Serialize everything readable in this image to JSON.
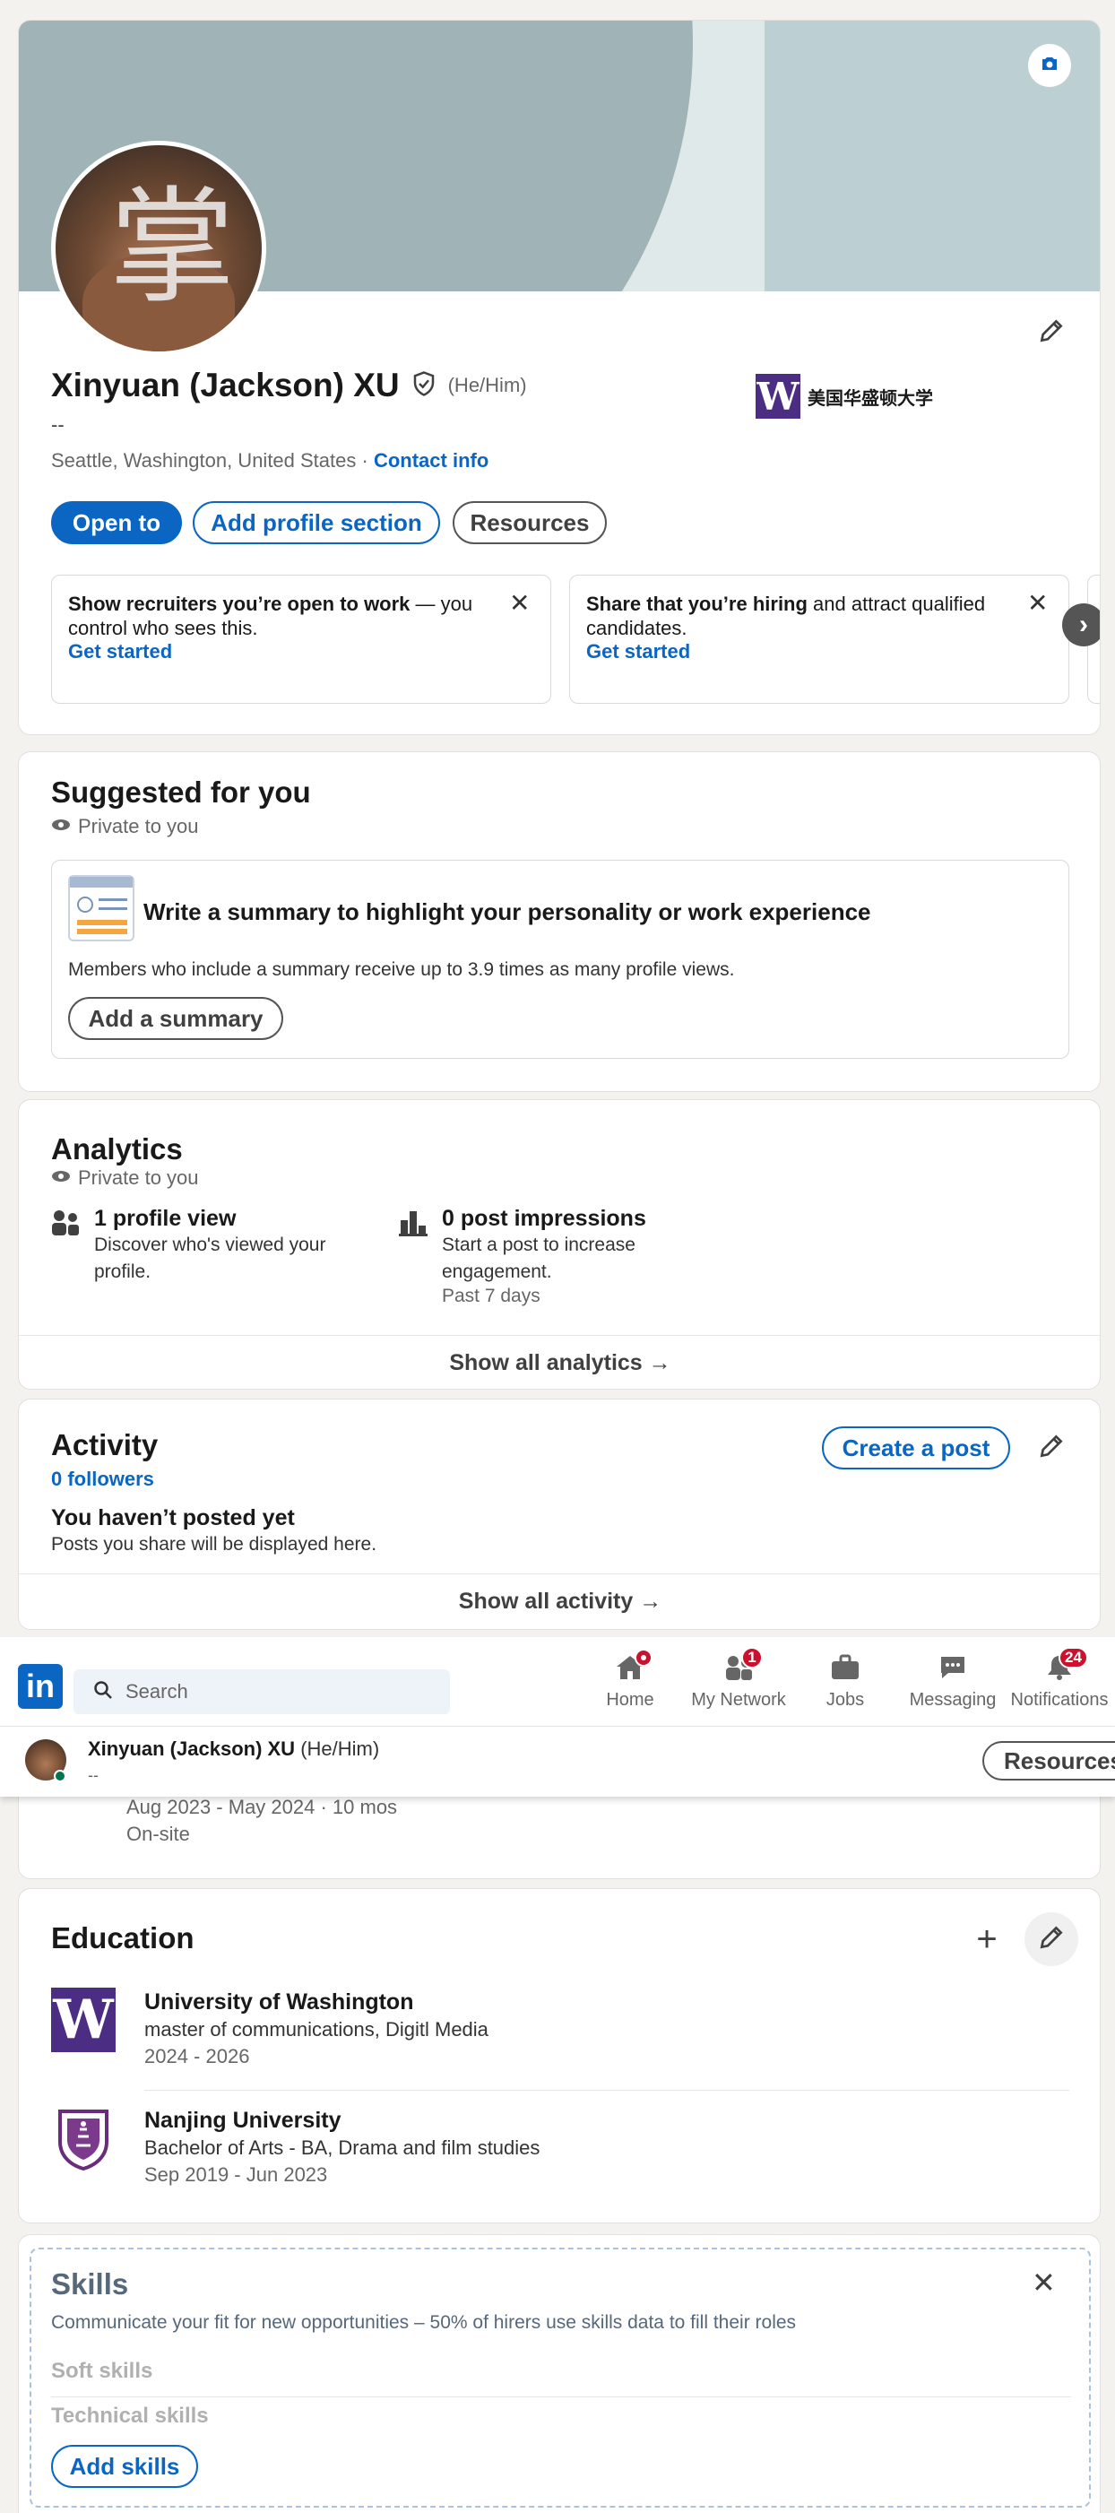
{
  "colors": {
    "brand": "#0a66c2",
    "banner": "#a0b4b7",
    "uw_purple": "#4b2e83",
    "notification": "#cb112d"
  },
  "profile": {
    "name": "Xinyuan (Jackson) XU",
    "pronouns": "(He/Him)",
    "headline": "--",
    "location": "Seattle, Washington, United States",
    "separator": "·",
    "contact_info": "Contact info",
    "school_logo_letter": "W",
    "school_name": "美国华盛顿大学",
    "avatar_text": "掌"
  },
  "actions": {
    "open_to": "Open to",
    "add_section": "Add profile section",
    "resources": "Resources"
  },
  "cards": {
    "recruiters": {
      "bold": "Show recruiters you’re open to work",
      "rest": " — you control who sees this.",
      "link": "Get started"
    },
    "hiring": {
      "bold": "Share that you’re hiring",
      "rest": " and attract qualified candidates.",
      "link": "Get started"
    }
  },
  "suggested": {
    "title": "Suggested for you",
    "private": "Private to you",
    "heading": "Write a summary to highlight your personality or work experience",
    "body": "Members who include a summary receive up to 3.9 times as many profile views.",
    "button": "Add a summary"
  },
  "analytics": {
    "title": "Analytics",
    "private": "Private to you",
    "items": [
      {
        "title": "1 profile view",
        "desc": "Discover who's viewed your profile.",
        "extra": ""
      },
      {
        "title": "0 post impressions",
        "desc": "Start a post to increase engagement.",
        "extra": "Past 7 days"
      }
    ],
    "show_all": "Show all analytics →"
  },
  "activity": {
    "title": "Activity",
    "followers": "0 followers",
    "create_post": "Create a post",
    "empty_title": "You haven’t posted yet",
    "empty_desc": "Posts you share will be displayed here.",
    "show_all": "Show all activity →"
  },
  "nav": {
    "logo": "in",
    "search_placeholder": "Search",
    "items": [
      {
        "label": "Home",
        "badge": ""
      },
      {
        "label": "My Network",
        "badge": "1"
      },
      {
        "label": "Jobs",
        "badge": ""
      },
      {
        "label": "Messaging",
        "badge": ""
      },
      {
        "label": "Notifications",
        "badge": "24"
      }
    ]
  },
  "sticky": {
    "name": "Xinyuan (Jackson) XU",
    "pronouns": "(He/Him)",
    "headline": "--",
    "resources": "Resources"
  },
  "experience": {
    "dates": "Aug 2023 - May 2024 · 10 mos",
    "location_type": "On-site"
  },
  "education": {
    "title": "Education",
    "items": [
      {
        "school": "University of Washington",
        "degree": "master of communications, Digitl Media",
        "years": "2024 - 2026",
        "logo": "W"
      },
      {
        "school": "Nanjing University",
        "degree": "Bachelor of Arts - BA, Drama and film studies",
        "years": "Sep 2019 - Jun 2023",
        "logo": ""
      }
    ]
  },
  "skills": {
    "title": "Skills",
    "desc": "Communicate your fit for new opportunities – 50% of hirers use skills data to fill their roles",
    "soft": "Soft skills",
    "technical": "Technical skills",
    "button": "Add skills"
  }
}
